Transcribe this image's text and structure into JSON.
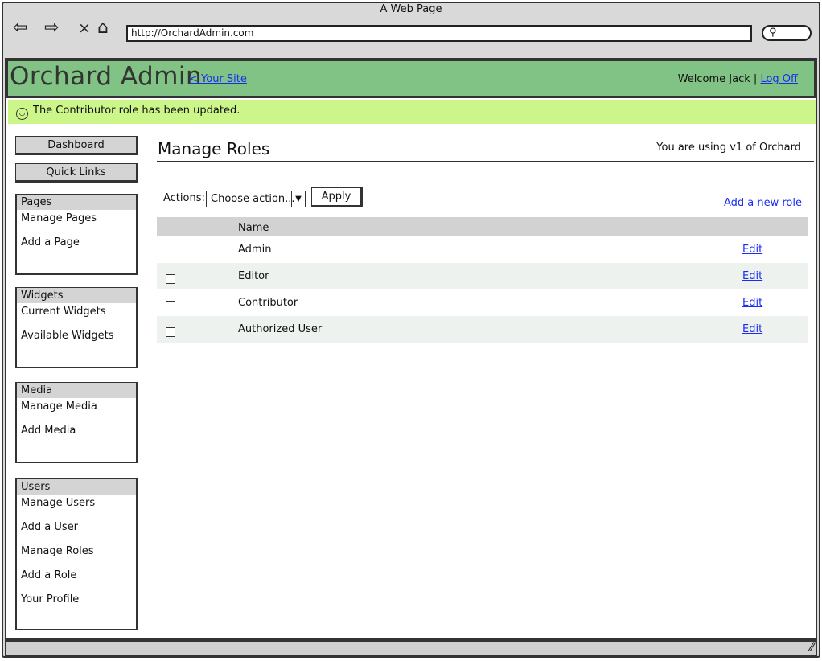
{
  "browser": {
    "title": "A Web Page",
    "url": "http://OrchardAdmin.com"
  },
  "header": {
    "app_title": "Orchard Admin",
    "your_site_link": "< Your Site",
    "welcome_text": "Welcome Jack",
    "separator": "|",
    "logoff_link": "Log Off",
    "bg_color": "#81c384"
  },
  "notice": {
    "text": "The Contributor role has been updated.",
    "icon": "smiley-icon",
    "bg_color": "#ccf58a"
  },
  "sidebar": {
    "dashboard_label": "Dashboard",
    "quick_links_label": "Quick Links",
    "sections": [
      {
        "title": "Pages",
        "items": [
          "Manage Pages",
          "Add a Page"
        ]
      },
      {
        "title": "Widgets",
        "items": [
          "Current Widgets",
          "Available Widgets"
        ]
      },
      {
        "title": "Media",
        "items": [
          "Manage Media",
          "Add Media"
        ]
      },
      {
        "title": "Users",
        "items": [
          "Manage Users",
          "Add a User",
          "Manage Roles",
          "Add a Role",
          "Your Profile"
        ]
      }
    ]
  },
  "main": {
    "title": "Manage Roles",
    "version_note": "You are using v1 of Orchard",
    "actions_label": "Actions:",
    "action_select_value": "Choose action...",
    "apply_label": "Apply",
    "add_role_link": "Add a new role",
    "table": {
      "name_header": "Name",
      "rows": [
        {
          "name": "Admin",
          "edit": "Edit"
        },
        {
          "name": "Editor",
          "edit": "Edit"
        },
        {
          "name": "Contributor",
          "edit": "Edit"
        },
        {
          "name": "Authorized User",
          "edit": "Edit"
        }
      ]
    }
  }
}
